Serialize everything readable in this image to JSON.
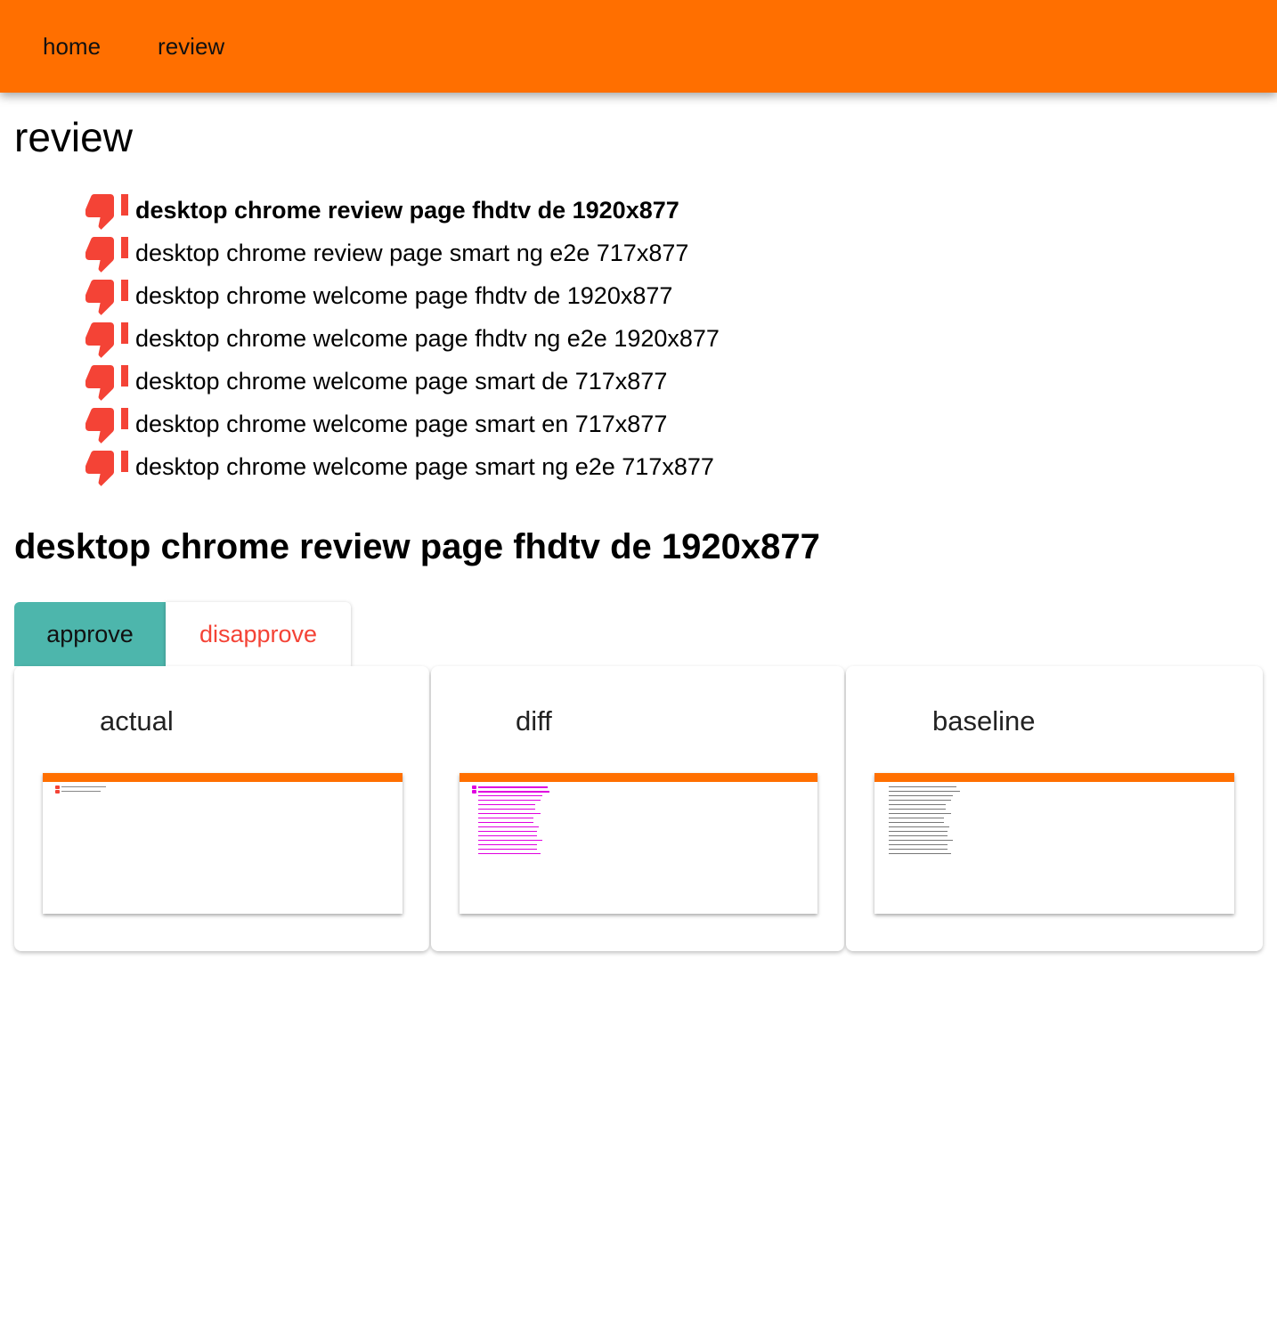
{
  "nav": {
    "home_label": "home",
    "review_label": "review",
    "bar_color": "#ff6f00"
  },
  "page": {
    "title": "review"
  },
  "review_items": [
    {
      "label": "desktop chrome review page fhdtv de 1920x877",
      "status_icon": "thumb-down-icon",
      "selected": true
    },
    {
      "label": "desktop chrome review page smart ng e2e 717x877",
      "status_icon": "thumb-down-icon",
      "selected": false
    },
    {
      "label": "desktop chrome welcome page fhdtv de 1920x877",
      "status_icon": "thumb-down-icon",
      "selected": false
    },
    {
      "label": "desktop chrome welcome page fhdtv ng e2e 1920x877",
      "status_icon": "thumb-down-icon",
      "selected": false
    },
    {
      "label": "desktop chrome welcome page smart de 717x877",
      "status_icon": "thumb-down-icon",
      "selected": false
    },
    {
      "label": "desktop chrome welcome page smart en 717x877",
      "status_icon": "thumb-down-icon",
      "selected": false
    },
    {
      "label": "desktop chrome welcome page smart ng e2e 717x877",
      "status_icon": "thumb-down-icon",
      "selected": false
    }
  ],
  "detail": {
    "title": "desktop chrome review page fhdtv de 1920x877",
    "approve_label": "approve",
    "disapprove_label": "disapprove",
    "approve_color": "#4db6ac",
    "disapprove_color": "#f44336"
  },
  "cards": [
    {
      "title": "actual"
    },
    {
      "title": "diff"
    },
    {
      "title": "baseline"
    }
  ],
  "colors": {
    "status_red": "#f44336",
    "diff_magenta": "#e000e0"
  }
}
